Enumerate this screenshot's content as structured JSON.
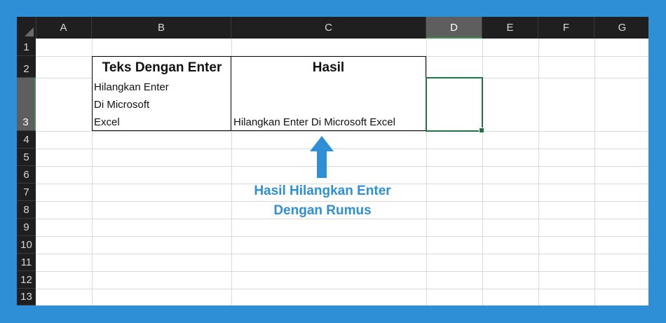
{
  "columns": [
    "A",
    "B",
    "C",
    "D",
    "E",
    "F",
    "G"
  ],
  "selected_column": "D",
  "rows": [
    "1",
    "2",
    "3",
    "4",
    "5",
    "6",
    "7",
    "8",
    "9",
    "10",
    "11",
    "12",
    "13"
  ],
  "selected_row": "3",
  "table": {
    "header_b": "Teks Dengan Enter",
    "header_c": "Hasil",
    "b3_lines": [
      "Hilangkan Enter",
      " Di Microsoft",
      " Excel"
    ],
    "c3": "Hilangkan Enter Di Microsoft Excel"
  },
  "annotation": {
    "line1": "Hasil Hilangkan Enter",
    "line2": "Dengan Rumus",
    "color": "#2e8fd6"
  },
  "colors": {
    "background": "#2e8fd6",
    "header_bg": "#1f1f1f",
    "selection": "#217346"
  }
}
